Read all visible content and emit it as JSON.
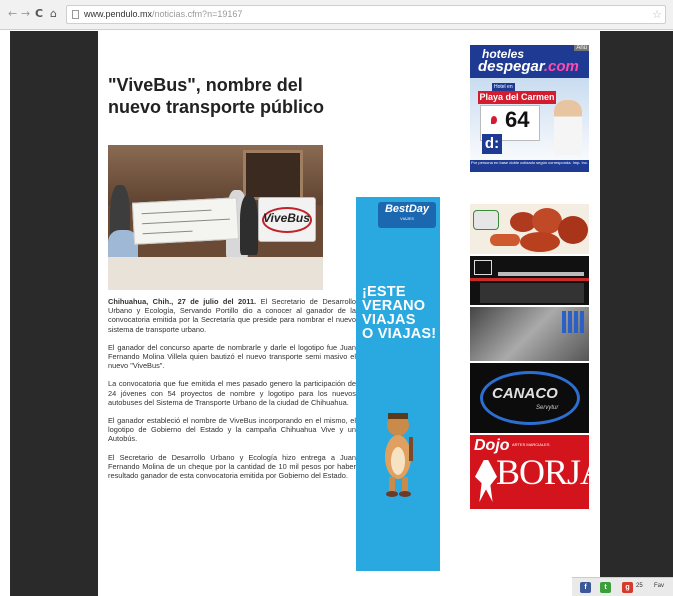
{
  "browser": {
    "url_domain": "www.pendulo.mx",
    "url_path": "/noticias.cfm?n=19167",
    "back_icon": "arrow-left-icon",
    "forward_icon": "arrow-right-icon",
    "reload_icon": "reload-icon",
    "home_icon": "home-icon",
    "bookmark_icon": "star-icon"
  },
  "article": {
    "headline": "\"ViveBus\", nombre del nuevo transporte público",
    "photo_sign_text": "ViveBus",
    "dateline": "Chihuahua, Chih., 27 de julio del 2011.",
    "paragraphs": [
      "El Secretario de Desarrollo Urbano y Ecología, Servando Portillo dio a conocer al ganador de la convocatoria emitida por la Secretaría que preside para nombrar el nuevo sistema de transporte urbano.",
      "El ganador del concurso aparte de nombrarle y darle el logotipo fue Juan Fernando Molina Villela quien bautizó el nuevo transporte semi masivo el nuevo \"ViveBus\".",
      "La convocatoria que fue emitida el mes pasado genero la participación de 24 jóvenes con 54 proyectos de nombre y logotipo para los nuevos autobuses del Sistema de Transporte Urbano de la ciudad de Chihuahua.",
      "El ganador estableció el nombre de ViveBus incorporando en el mismo, el logotipo de Gobierno del Estado y la campaña Chihuahua Vive y un Autobús.",
      "El Secretario de Desarrollo Urbano y Ecología hizo entrega a Juan Fernando Molina de un cheque por la cantidad de 10 mil pesos por haber resultado ganador de esta convocatoria emitida por Gobierno del Estado."
    ]
  },
  "ads": {
    "bestday": {
      "logo": "BestDay",
      "logo_sub": "VIAJES",
      "lines": [
        "¡ESTE",
        "VERANO",
        "VIAJAS",
        "O VIAJAS!"
      ]
    },
    "despegar": {
      "brand_top": "hoteles",
      "brand_name": "despegar",
      "brand_tld": ".com",
      "ad_tag": "Anú",
      "hotel_label": "Hotel en",
      "destination": "Playa del Carmen",
      "price": "64",
      "d_logo": "d:",
      "footer": "Por persona en base doble cotizado según corresponda. Imp. Inc."
    },
    "canaco": {
      "name": "CANACO",
      "city": "Servytur"
    },
    "dojo": {
      "top": "Dojo",
      "sub": "ARTES MARCIALES",
      "name": "BORJAS"
    }
  },
  "share": {
    "facebook": "f",
    "twitter": "t",
    "gplus": "g",
    "count": "25",
    "more": "Fav"
  }
}
